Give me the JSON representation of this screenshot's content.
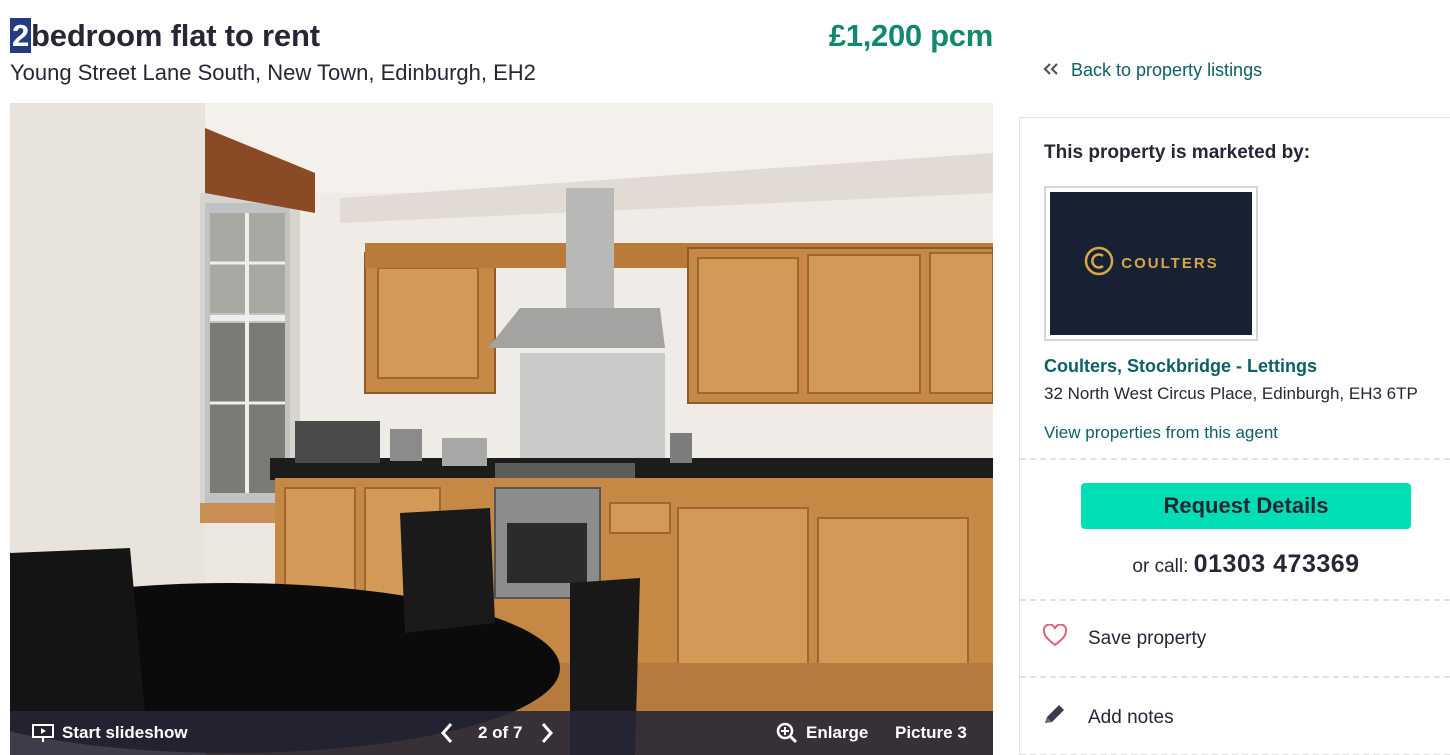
{
  "listing": {
    "title_num": "2",
    "title_rest": "bedroom flat to rent",
    "price": "£1,200 pcm",
    "address": "Young Street Lane South, New Town, Edinburgh, EH2"
  },
  "gallery": {
    "slideshow_label": "Start slideshow",
    "counter": "2 of 7",
    "enlarge_label": "Enlarge",
    "picture_label": "Picture 3",
    "icons": [
      "slideshow-icon",
      "chevron-left-icon",
      "chevron-right-icon",
      "zoom-icon"
    ]
  },
  "sidebar": {
    "back_label": "Back to property listings",
    "marketed_by": "This property is marketed by:",
    "logo_text": "COULTERS",
    "agent_name": "Coulters, Stockbridge - Lettings",
    "agent_address": "32 North West Circus Place, Edinburgh, EH3 6TP",
    "view_properties": "View properties from this agent",
    "request_label": "Request Details",
    "call_prefix": "or call:",
    "phone": "01303 473369",
    "save_label": "Save property",
    "notes_label": "Add notes"
  },
  "colors": {
    "accent": "#00deb6",
    "price": "#138870",
    "link": "#0c5f65",
    "text": "#262637",
    "logo_bg": "#182033",
    "logo_gold": "#d4a848",
    "heart": "#e2607a"
  }
}
